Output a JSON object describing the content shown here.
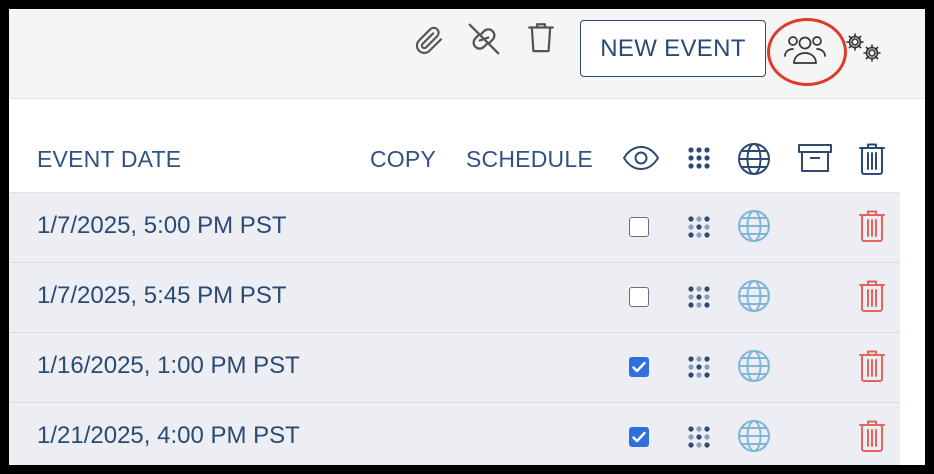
{
  "toolbar": {
    "icons": [
      "paperclip-icon",
      "unlink-icon",
      "trash-icon"
    ],
    "new_event_label": "NEW EVENT",
    "users_icon": "users-icon",
    "settings_icon": "settings-icon",
    "highlight_color": "#e03a2c"
  },
  "table": {
    "headers": {
      "event_date": "EVENT DATE",
      "copy": "COPY",
      "schedule": "SCHEDULE",
      "icons": [
        "eye-icon",
        "drag-grid-icon",
        "globe-icon",
        "archive-icon",
        "trash-icon"
      ]
    },
    "rows": [
      {
        "date": "1/7/2025, 5:00 PM PST",
        "checked": false
      },
      {
        "date": "1/7/2025, 5:45 PM PST",
        "checked": false
      },
      {
        "date": "1/16/2025, 1:00 PM PST",
        "checked": true
      },
      {
        "date": "1/21/2025, 4:00 PM PST",
        "checked": true
      }
    ]
  },
  "colors": {
    "text": "#2b4a73",
    "row_bg": "#eceef3",
    "globe": "#7fb6d8",
    "trash_row": "#e0665e",
    "checkbox_on": "#2f6fde"
  }
}
